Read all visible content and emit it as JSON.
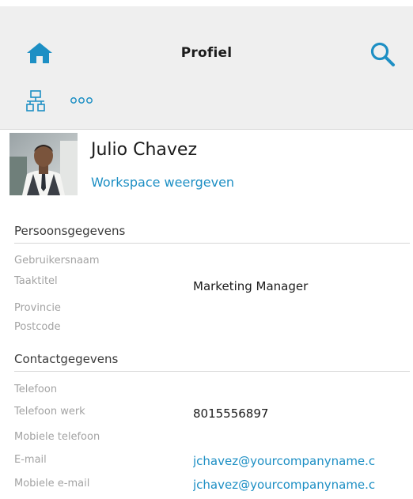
{
  "colors": {
    "accent": "#1d8fc4",
    "header_bg": "#efefef",
    "label_gray": "#a3a3a3",
    "text_dark": "#1b1b1b"
  },
  "header": {
    "title": "Profiel",
    "home_icon": "home-icon",
    "search_icon": "search-icon",
    "org_icon": "org-chart-icon",
    "more_icon": "more-options-icon"
  },
  "profile": {
    "name": "Julio Chavez",
    "workspace_link": "Workspace weergeven",
    "avatar_icon": "user-photo"
  },
  "sections": {
    "personal": {
      "title": "Persoonsgegevens",
      "fields": [
        {
          "label": "Gebruikersnaam",
          "value": ""
        },
        {
          "label": "Taaktitel",
          "value": "Marketing Manager"
        },
        {
          "label": "Provincie",
          "value": ""
        },
        {
          "label": "Postcode",
          "value": ""
        }
      ]
    },
    "contact": {
      "title": "Contactgegevens",
      "fields": [
        {
          "label": "Telefoon",
          "value": ""
        },
        {
          "label": "Telefoon werk",
          "value": "8015556897"
        },
        {
          "label": "Mobiele telefoon",
          "value": ""
        },
        {
          "label": "E-mail",
          "value": "jchavez@yourcompanyname.c"
        },
        {
          "label": "Mobiele e-mail",
          "value": "jchavez@yourcompanyname.c"
        }
      ]
    }
  }
}
